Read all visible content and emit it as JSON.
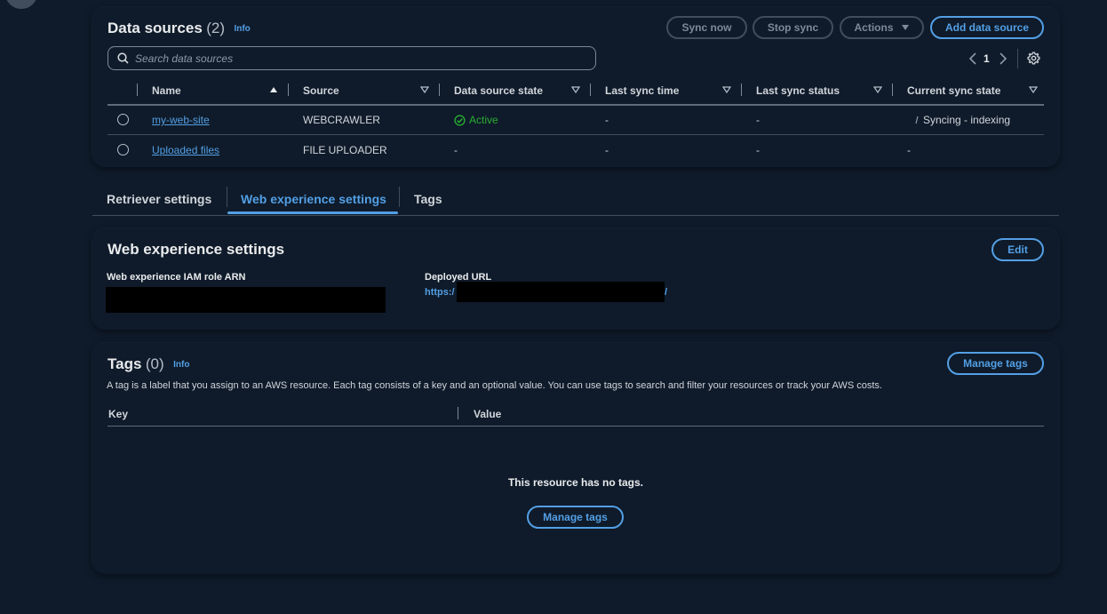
{
  "data_sources": {
    "title": "Data sources",
    "count": "(2)",
    "info": "Info",
    "search_placeholder": "Search data sources",
    "buttons": {
      "sync_now": "Sync now",
      "stop_sync": "Stop sync",
      "actions": "Actions",
      "add": "Add data source"
    },
    "page": "1",
    "columns": [
      "Name",
      "Source",
      "Data source state",
      "Last sync time",
      "Last sync status",
      "Current sync state"
    ],
    "rows": [
      {
        "name": "my-web-site",
        "source": "WEBCRAWLER",
        "state": "Active",
        "last_sync_time": "-",
        "last_sync_status": "-",
        "current_sync_state": "Syncing - indexing"
      },
      {
        "name": "Uploaded files",
        "source": "FILE UPLOADER",
        "state": "-",
        "last_sync_time": "-",
        "last_sync_status": "-",
        "current_sync_state": "-"
      }
    ]
  },
  "tabs": [
    "Retriever settings",
    "Web experience settings",
    "Tags"
  ],
  "active_tab": "Web experience settings",
  "web_experience": {
    "title": "Web experience settings",
    "edit": "Edit",
    "iam_role_label": "Web experience IAM role ARN",
    "url_label": "Deployed URL",
    "url_prefix": "https:/",
    "url_suffix": "/"
  },
  "tags": {
    "title": "Tags",
    "count": "(0)",
    "info": "Info",
    "manage": "Manage tags",
    "description": "A tag is a label that you assign to an AWS resource. Each tag consists of a key and an optional value. You can use tags to search and filter your resources or track your AWS costs.",
    "columns": [
      "Key",
      "Value"
    ],
    "empty": "This resource has no tags.",
    "empty_button": "Manage tags"
  },
  "colors": {
    "background": "#0f1b2a",
    "accent": "#539fe5",
    "success": "#29ad32"
  }
}
